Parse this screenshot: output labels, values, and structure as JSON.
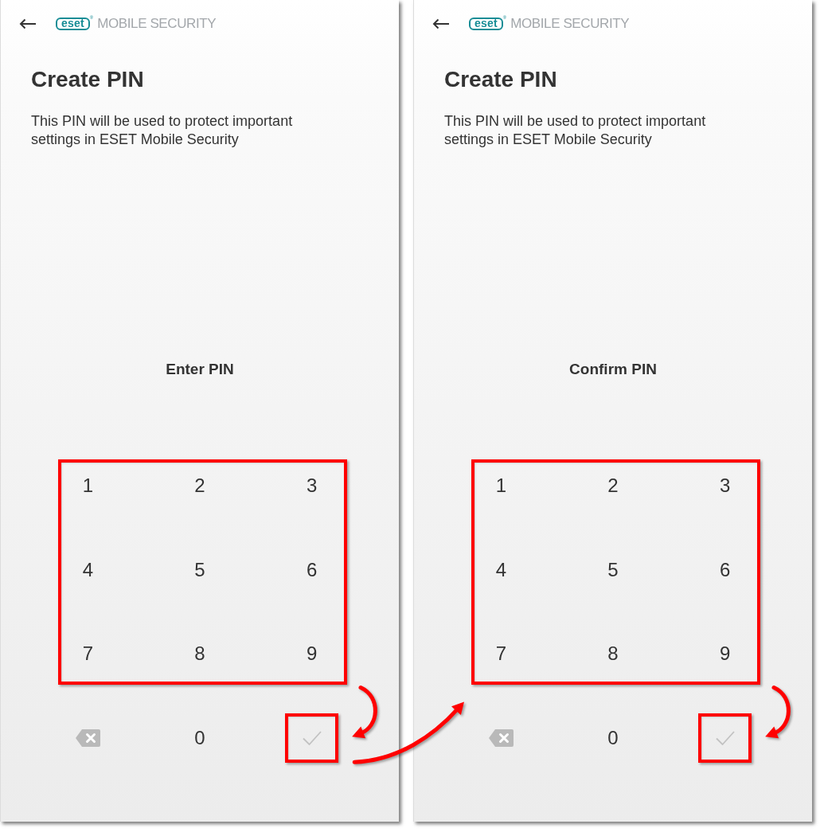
{
  "screens": [
    {
      "header": {
        "logo": "eset",
        "logo_mark": "®",
        "product": "MOBILE SECURITY"
      },
      "title": "Create PIN",
      "description": "This PIN will be used to protect important settings in ESET Mobile Security",
      "prompt": "Enter PIN",
      "keypad": {
        "digits_highlighted": true,
        "keys": [
          {
            "kind": "digit",
            "label": "1"
          },
          {
            "kind": "digit",
            "label": "2"
          },
          {
            "kind": "digit",
            "label": "3"
          },
          {
            "kind": "digit",
            "label": "4"
          },
          {
            "kind": "digit",
            "label": "5"
          },
          {
            "kind": "digit",
            "label": "6"
          },
          {
            "kind": "digit",
            "label": "7"
          },
          {
            "kind": "digit",
            "label": "8"
          },
          {
            "kind": "digit",
            "label": "9"
          },
          {
            "kind": "backspace",
            "disabled": true
          },
          {
            "kind": "digit",
            "label": "0"
          },
          {
            "kind": "confirm",
            "disabled": true,
            "highlighted": true
          }
        ]
      },
      "arrow_to_confirm": true
    },
    {
      "header": {
        "logo": "eset",
        "logo_mark": "®",
        "product": "MOBILE SECURITY"
      },
      "title": "Create PIN",
      "description": "This PIN will be used to protect important settings in ESET Mobile Security",
      "prompt": "Confirm PIN",
      "keypad": {
        "digits_highlighted": true,
        "keys": [
          {
            "kind": "digit",
            "label": "1"
          },
          {
            "kind": "digit",
            "label": "2"
          },
          {
            "kind": "digit",
            "label": "3"
          },
          {
            "kind": "digit",
            "label": "4"
          },
          {
            "kind": "digit",
            "label": "5"
          },
          {
            "kind": "digit",
            "label": "6"
          },
          {
            "kind": "digit",
            "label": "7"
          },
          {
            "kind": "digit",
            "label": "8"
          },
          {
            "kind": "digit",
            "label": "9"
          },
          {
            "kind": "backspace",
            "disabled": true
          },
          {
            "kind": "digit",
            "label": "0"
          },
          {
            "kind": "confirm",
            "disabled": true,
            "highlighted": true
          }
        ]
      },
      "arrow_to_confirm": true
    }
  ],
  "arrow_between_screens": true
}
